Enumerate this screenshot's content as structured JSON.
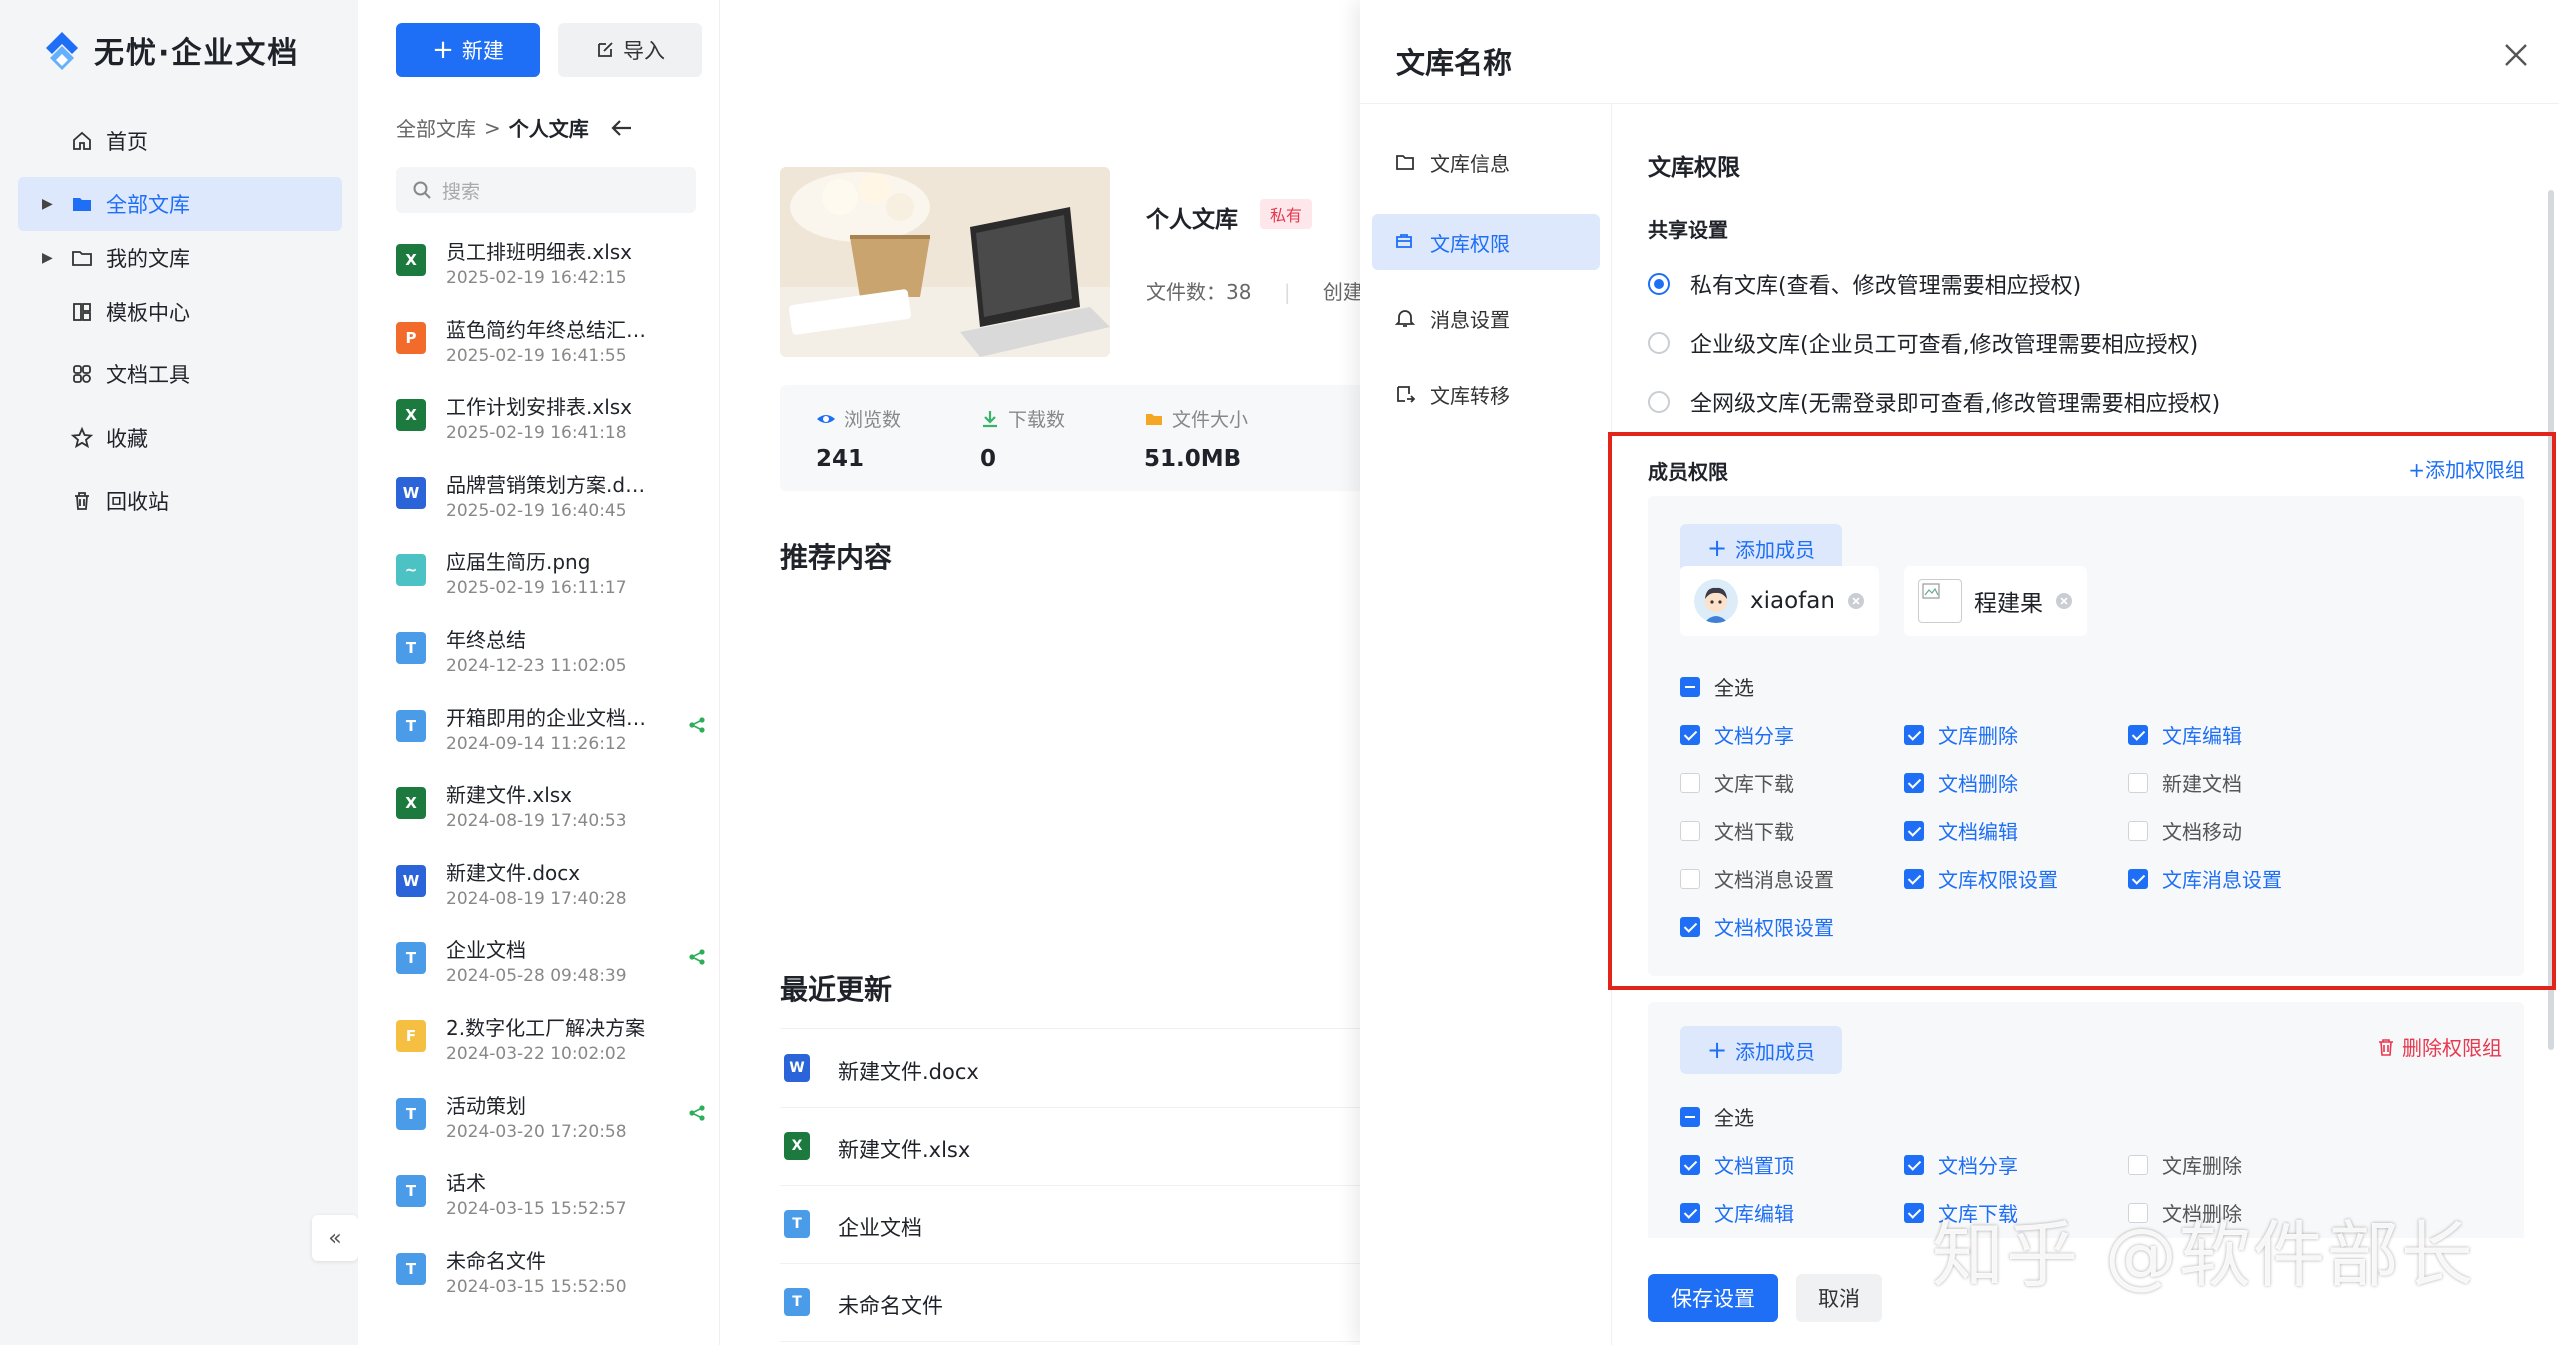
{
  "app": {
    "brand": "无忧·企业文档"
  },
  "nav": {
    "items": [
      {
        "label": "首页",
        "icon": "home-icon"
      },
      {
        "label": "全部文库",
        "icon": "folder-icon"
      },
      {
        "label": "我的文库",
        "icon": "folder-outline-icon"
      },
      {
        "label": "模板中心",
        "icon": "template-icon"
      },
      {
        "label": "文档工具",
        "icon": "tools-icon"
      },
      {
        "label": "收藏",
        "icon": "star-icon"
      },
      {
        "label": "回收站",
        "icon": "trash-icon"
      }
    ],
    "collapse_glyph": "«"
  },
  "toolbar": {
    "new_label": "新建",
    "import_label": "导入"
  },
  "breadcrumb": {
    "root": "全部文库",
    "separator": ">",
    "current": "个人文库"
  },
  "search": {
    "placeholder": "搜索"
  },
  "files": [
    {
      "name": "员工排班明细表.xlsx",
      "date": "2025-02-19 16:42:15",
      "type": "X",
      "color": "#1d7a3f",
      "shared": false
    },
    {
      "name": "蓝色简约年终总结汇报.pptx",
      "date": "2025-02-19 16:41:55",
      "type": "P",
      "color": "#f26b2a",
      "shared": false
    },
    {
      "name": "工作计划安排表.xlsx",
      "date": "2025-02-19 16:41:18",
      "type": "X",
      "color": "#1d7a3f",
      "shared": false
    },
    {
      "name": "品牌营销策划方案.docx",
      "date": "2025-02-19 16:40:45",
      "type": "W",
      "color": "#2b63d9",
      "shared": false
    },
    {
      "name": "应届生简历.png",
      "date": "2025-02-19 16:11:17",
      "type": "~",
      "color": "#4cc2c4",
      "shared": false
    },
    {
      "name": "年终总结",
      "date": "2024-12-23 11:02:05",
      "type": "T",
      "color": "#4a9be8",
      "shared": false
    },
    {
      "name": "开箱即用的企业文档管理系统",
      "date": "2024-09-14 11:26:12",
      "type": "T",
      "color": "#4a9be8",
      "shared": true
    },
    {
      "name": "新建文件.xlsx",
      "date": "2024-08-19 17:40:53",
      "type": "X",
      "color": "#1d7a3f",
      "shared": false
    },
    {
      "name": "新建文件.docx",
      "date": "2024-08-19 17:40:28",
      "type": "W",
      "color": "#2b63d9",
      "shared": false
    },
    {
      "name": "企业文档",
      "date": "2024-05-28 09:48:39",
      "type": "T",
      "color": "#4a9be8",
      "shared": true
    },
    {
      "name": "2.数字化工厂解决方案",
      "date": "2024-03-22 10:02:02",
      "type": "F",
      "color": "#f5c042",
      "shared": false
    },
    {
      "name": "活动策划",
      "date": "2024-03-20 17:20:58",
      "type": "T",
      "color": "#4a9be8",
      "shared": true
    },
    {
      "name": "话术",
      "date": "2024-03-15 15:52:57",
      "type": "T",
      "color": "#4a9be8",
      "shared": false
    },
    {
      "name": "未命名文件",
      "date": "2024-03-15 15:52:50",
      "type": "T",
      "color": "#4a9be8",
      "shared": false
    }
  ],
  "library": {
    "title": "个人文库",
    "badge": "私有",
    "file_count_label": "文件数：38",
    "created_label": "创建",
    "stats": [
      {
        "label": "浏览数",
        "value": "241",
        "icon": "eye-icon",
        "color": "#1e6ff5"
      },
      {
        "label": "下载数",
        "value": "0",
        "icon": "download-icon",
        "color": "#3bb36a"
      },
      {
        "label": "文件大小",
        "value": "51.0MB",
        "icon": "folder-size-icon",
        "color": "#f5a623"
      }
    ],
    "recommended_title": "推荐内容",
    "recent_title": "最近更新",
    "recent": [
      {
        "name": "新建文件.docx",
        "type": "W",
        "color": "#2b63d9"
      },
      {
        "name": "新建文件.xlsx",
        "type": "X",
        "color": "#1d7a3f"
      },
      {
        "name": "企业文档",
        "type": "T",
        "color": "#4a9be8"
      },
      {
        "name": "未命名文件",
        "type": "T",
        "color": "#4a9be8"
      }
    ]
  },
  "drawer": {
    "title": "文库名称",
    "menu": [
      {
        "label": "文库信息",
        "icon": "info-folder-icon"
      },
      {
        "label": "文库权限",
        "icon": "permission-icon"
      },
      {
        "label": "消息设置",
        "icon": "bell-icon"
      },
      {
        "label": "文库转移",
        "icon": "transfer-icon"
      }
    ],
    "permission_title": "文库权限",
    "share_title": "共享设置",
    "share_options": [
      {
        "label": "私有文库(查看、修改管理需要相应授权)",
        "checked": true
      },
      {
        "label": "企业级文库(企业员工可查看,修改管理需要相应授权)",
        "checked": false
      },
      {
        "label": "全网级文库(无需登录即可查看,修改管理需要相应授权)",
        "checked": false
      }
    ],
    "member_title": "成员权限",
    "add_group_label": "添加权限组",
    "add_member_label": "添加成员",
    "delete_group_label": "删除权限组",
    "select_all_label": "全选",
    "group1": {
      "members": [
        {
          "name": "xiaofan"
        },
        {
          "name": "程建果"
        }
      ],
      "permissions": [
        {
          "label": "文档分享",
          "checked": true
        },
        {
          "label": "文库删除",
          "checked": true
        },
        {
          "label": "文库编辑",
          "checked": true
        },
        {
          "label": "文库下载",
          "checked": false
        },
        {
          "label": "文档删除",
          "checked": true
        },
        {
          "label": "新建文档",
          "checked": false
        },
        {
          "label": "文档下载",
          "checked": false
        },
        {
          "label": "文档编辑",
          "checked": true
        },
        {
          "label": "文档移动",
          "checked": false
        },
        {
          "label": "文档消息设置",
          "checked": false
        },
        {
          "label": "文库权限设置",
          "checked": true
        },
        {
          "label": "文库消息设置",
          "checked": true
        },
        {
          "label": "文档权限设置",
          "checked": true
        }
      ]
    },
    "group2": {
      "permissions": [
        {
          "label": "文档置顶",
          "checked": true
        },
        {
          "label": "文档分享",
          "checked": true
        },
        {
          "label": "文库删除",
          "checked": false
        },
        {
          "label": "文库编辑",
          "checked": true
        },
        {
          "label": "文库下载",
          "checked": true
        },
        {
          "label": "文档删除",
          "checked": false
        }
      ]
    },
    "save_label": "保存设置",
    "cancel_label": "取消"
  },
  "watermark": "知乎 @软件部长"
}
